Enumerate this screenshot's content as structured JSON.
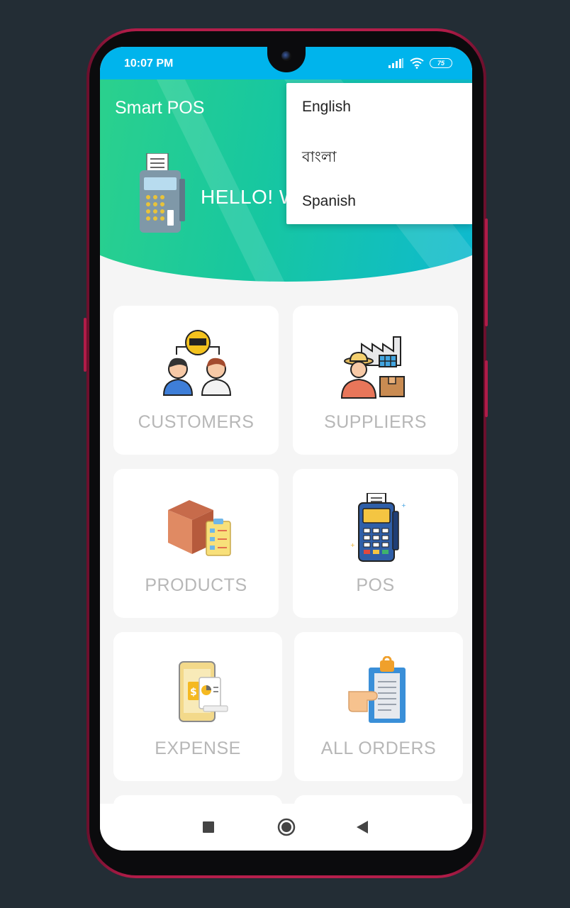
{
  "status_bar": {
    "time": "10:07 PM",
    "battery": "75",
    "icons": [
      "signal-icon",
      "wifi-icon",
      "battery-icon"
    ]
  },
  "app": {
    "title": "Smart POS",
    "greeting": "HELLO! W"
  },
  "menu_cards": [
    {
      "label": "CUSTOMERS",
      "icon": "customers-icon"
    },
    {
      "label": "SUPPLIERS",
      "icon": "suppliers-icon"
    },
    {
      "label": "PRODUCTS",
      "icon": "products-icon"
    },
    {
      "label": "POS",
      "icon": "pos-terminal-icon"
    },
    {
      "label": "EXPENSE",
      "icon": "expense-icon"
    },
    {
      "label": "ALL ORDERS",
      "icon": "all-orders-icon"
    }
  ],
  "language_menu": {
    "options": [
      "English",
      "বাংলা",
      "Spanish"
    ]
  },
  "nav_bar": {
    "buttons": [
      "recent-apps-icon",
      "home-icon",
      "back-icon"
    ]
  },
  "colors": {
    "status_bar": "#00b4ec",
    "header_start": "#2ed28a",
    "header_end": "#0db8d5",
    "card_label": "#b7b7b7",
    "background": "#232d35"
  }
}
